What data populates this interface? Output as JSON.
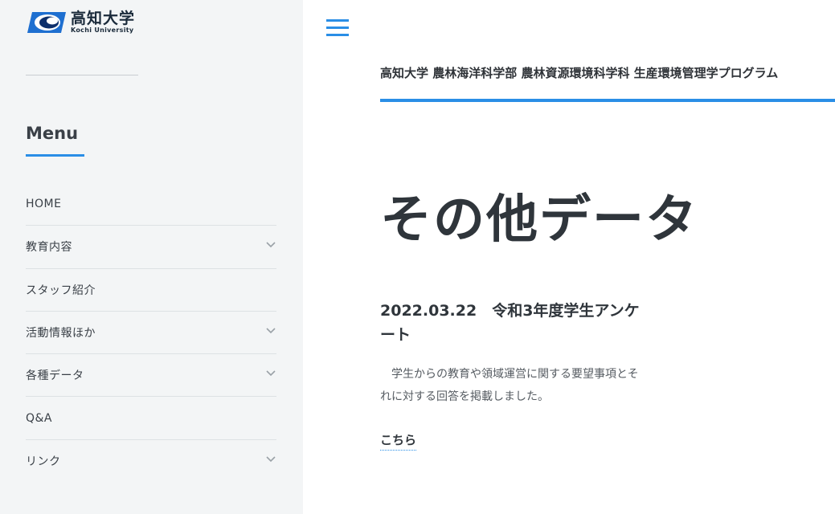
{
  "logo": {
    "name_ja": "高知大学",
    "name_en": "Kochi University",
    "colors": {
      "primary": "#1e6fd0",
      "dark": "#0d2f6b"
    }
  },
  "sidebar": {
    "menu_title": "Menu",
    "items": [
      {
        "label": "HOME",
        "has_submenu": false
      },
      {
        "label": "教育内容",
        "has_submenu": true
      },
      {
        "label": "スタッフ紹介",
        "has_submenu": false
      },
      {
        "label": "活動情報ほか",
        "has_submenu": true
      },
      {
        "label": "各種データ",
        "has_submenu": true
      },
      {
        "label": "Q&A",
        "has_submenu": false
      },
      {
        "label": "リンク",
        "has_submenu": true
      }
    ]
  },
  "header": {
    "site_title": "高知大学 農林海洋科学部 農林資源環境科学科 生産環境管理学プログラム"
  },
  "main": {
    "page_title": "その他データ",
    "post": {
      "title": "2022.03.22　令和3年度学生アンケート",
      "body": "学生からの教育や領域運営に関する要望事項とそれに対する回答を掲載しました。",
      "link_label": "こちら"
    }
  },
  "colors": {
    "accent": "#2a8ee6",
    "sidebar_bg": "#f3f5f6",
    "text_dark": "#2f353b"
  }
}
